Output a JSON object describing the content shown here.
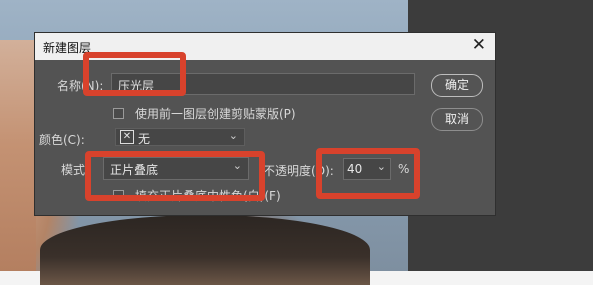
{
  "dialog": {
    "title": "新建图层",
    "close_symbol": "✕",
    "name_label": "名称(N):",
    "name_value": "压光层",
    "clip_mask_label": "使用前一图层创建剪贴蒙版(P)",
    "color_label": "颜色(C):",
    "color_value": "无",
    "color_swatch_symbol": "✕",
    "mode_label": "模式:",
    "mode_value": "正片叠底",
    "opacity_label": "不透明度(O):",
    "opacity_value": "40",
    "opacity_unit": "%",
    "fill_neutral_label": "填充正片叠底中性色(白)(F)",
    "ok_label": "确定",
    "cancel_label": "取消",
    "dropdown_symbol": "⌄"
  },
  "annotation_color": "#d8422c"
}
